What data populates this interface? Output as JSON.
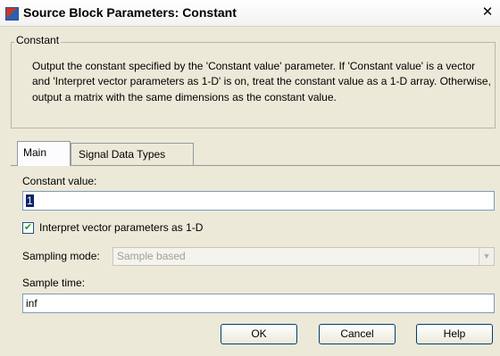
{
  "window": {
    "title": "Source Block Parameters: Constant",
    "close_glyph": "✕"
  },
  "group": {
    "title": "Constant",
    "description": "Output the constant specified by the 'Constant value' parameter. If 'Constant value' is a vector and 'Interpret vector parameters as 1-D' is on, treat the constant value as a 1-D array. Otherwise, output a matrix with the same dimensions as the constant value."
  },
  "tabs": [
    {
      "label": "Main",
      "active": true
    },
    {
      "label": "Signal Data Types",
      "active": false
    }
  ],
  "main": {
    "constant_value": {
      "label": "Constant value:",
      "value": "1"
    },
    "interpret_vector": {
      "label": "Interpret vector parameters as 1-D",
      "checked": true,
      "check_glyph": "✔"
    },
    "sampling_mode": {
      "label": "Sampling mode:",
      "value": "Sample based",
      "disabled": true,
      "arrow_glyph": "▼"
    },
    "sample_time": {
      "label": "Sample time:",
      "value": "inf"
    }
  },
  "buttons": {
    "ok": "OK",
    "cancel": "Cancel",
    "help": "Help"
  },
  "colors": {
    "dialog_bg": "#ece9d8",
    "selection": "#0a246a",
    "field_border": "#7f9db9"
  }
}
